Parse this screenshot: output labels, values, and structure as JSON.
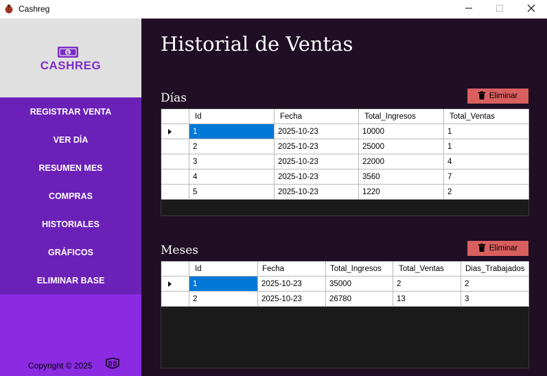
{
  "window": {
    "title": "Cashreg",
    "icon": "ladybug-icon",
    "controls": [
      "minimize-icon",
      "maximize-icon",
      "close-icon"
    ]
  },
  "sidebar": {
    "logo_text": "CASHREG",
    "logo_icon": "cash-icon",
    "items": [
      {
        "label": "REGISTRAR VENTA"
      },
      {
        "label": "VER DÍA"
      },
      {
        "label": "RESUMEN MES"
      },
      {
        "label": "COMPRAS"
      },
      {
        "label": "HISTORIALES"
      },
      {
        "label": "GRÁFICOS"
      },
      {
        "label": "ELIMINAR BASE"
      }
    ],
    "copyright": "Copyright ©  2025"
  },
  "main": {
    "title": "Historial de Ventas",
    "days": {
      "title": "Días",
      "delete_label": "Eliminar",
      "columns": [
        "Id",
        "Fecha",
        "Total_Ingresos",
        "Total_Ventas"
      ],
      "rows": [
        [
          "1",
          "2025-10-23",
          "10000",
          "1"
        ],
        [
          "2",
          "2025-10-23",
          "25000",
          "1"
        ],
        [
          "3",
          "2025-10-23",
          "22000",
          "4"
        ],
        [
          "4",
          "2025-10-23",
          "3560",
          "7"
        ],
        [
          "5",
          "2025-10-23",
          "1220",
          "2"
        ]
      ]
    },
    "months": {
      "title": "Meses",
      "delete_label": "Eliminar",
      "columns": [
        "Id",
        "Fecha",
        "Total_Ingresos",
        "Total_Ventas",
        "Dias_Trabajados"
      ],
      "rows": [
        [
          "1",
          "2025-10-23",
          "35000",
          "2",
          "2"
        ],
        [
          "2",
          "2025-10-23",
          "26780",
          "13",
          "3"
        ]
      ]
    }
  },
  "colors": {
    "sidebar_bg": "#8a2be2",
    "menu_bg": "#6b21b8",
    "main_bg": "#1f0e24",
    "delete_button": "#d95f5f",
    "selection": "#0078d7"
  }
}
